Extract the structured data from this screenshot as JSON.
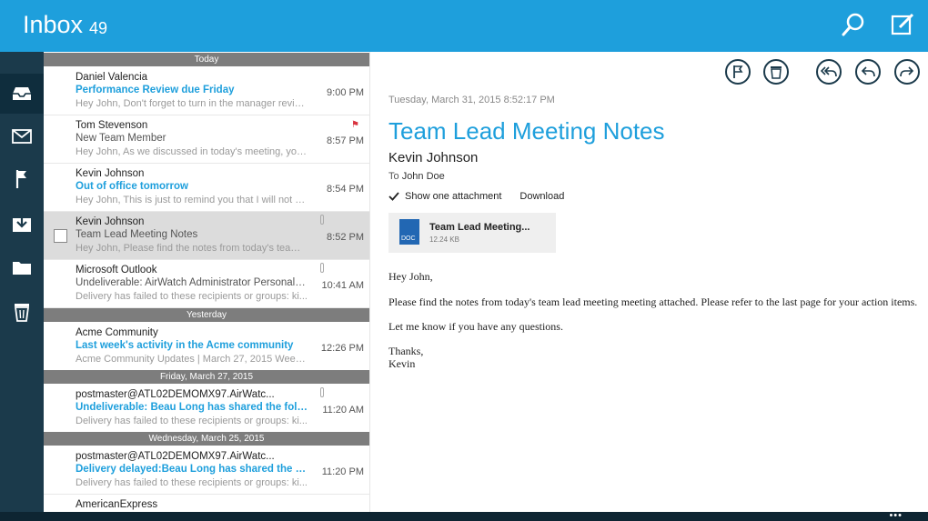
{
  "header": {
    "title": "Inbox",
    "count": "49"
  },
  "icons": {
    "search": "search-icon",
    "compose": "compose-icon",
    "inbox": "inbox-icon",
    "mail": "mail-icon",
    "flag": "flag-icon",
    "archive": "archive-icon",
    "folder": "folder-icon",
    "trash": "trash-icon",
    "reply_all": "reply-all-icon",
    "reply": "reply-icon",
    "forward": "forward-icon",
    "delete": "delete-icon"
  },
  "separators": {
    "today": "Today",
    "yesterday": "Yesterday",
    "fri": "Friday, March 27, 2015",
    "wed": "Wednesday, March 25, 2015"
  },
  "messages": [
    {
      "from": "Daniel Valencia",
      "subject": "Performance Review due Friday",
      "preview": "Hey John, Don't forget to turn in the manager revie...",
      "time": "9:00 PM"
    },
    {
      "from": "Tom Stevenson",
      "subject": "New Team Member",
      "preview": "Hey John, As we discussed in today's meeting, you...",
      "time": "8:57 PM"
    },
    {
      "from": "Kevin Johnson",
      "subject": "Out of office tomorrow",
      "preview": "Hey John, This is just to remind you that I will not b...",
      "time": "8:54 PM"
    },
    {
      "from": "Kevin Johnson",
      "subject": "Team Lead Meeting Notes",
      "preview": "Hey John, Please find the notes from today's team l...",
      "time": "8:52 PM"
    },
    {
      "from": "Microsoft Outlook",
      "subject": "Undeliverable: AirWatch Administrator Personal Inf...",
      "preview": "Delivery has failed to these recipients or groups: ki...",
      "time": "10:41 AM"
    },
    {
      "from": "Acme Community",
      "subject": "Last week's activity in the Acme community",
      "preview": "Acme Community Updates | March 27, 2015 Week...",
      "time": "12:26 PM"
    },
    {
      "from": "postmaster@ATL02DEMOMX97.AirWatc...",
      "subject": "Undeliverable: Beau Long has shared the fold...",
      "preview": "Delivery has failed to these recipients or groups: ki...",
      "time": "11:20 AM"
    },
    {
      "from": "postmaster@ATL02DEMOMX97.AirWatc...",
      "subject": "Delivery delayed:Beau Long has shared the fol...",
      "preview": "Delivery has failed to these recipients or groups: ki...",
      "time": "11:20 PM"
    },
    {
      "from": "AmericanExpress",
      "subject": "",
      "preview": "",
      "time": ""
    }
  ],
  "reading": {
    "date": "Tuesday, March 31, 2015 8:52:17 PM",
    "subject": "Team Lead Meeting Notes",
    "sender": "Kevin Johnson",
    "to_prefix": "To",
    "to_name": "John Doe",
    "show_attachment": "Show one attachment",
    "download": "Download",
    "attachment_name": "Team Lead Meeting...",
    "attachment_size": "12.24 KB",
    "attachment_type": "DOC",
    "body": {
      "greeting": "Hey John,",
      "line1": "Please find the notes from today's team lead meeting meeting attached. Please refer to the last page for your action items.",
      "line2": "Let me know if you have any questions.",
      "closing": "Thanks,",
      "signature": "Kevin"
    }
  },
  "bottom": {
    "more": "•••"
  },
  "colors": {
    "accent": "#1e9fdc",
    "sidebar": "#1b3a4b",
    "flag": "#d9333f"
  }
}
